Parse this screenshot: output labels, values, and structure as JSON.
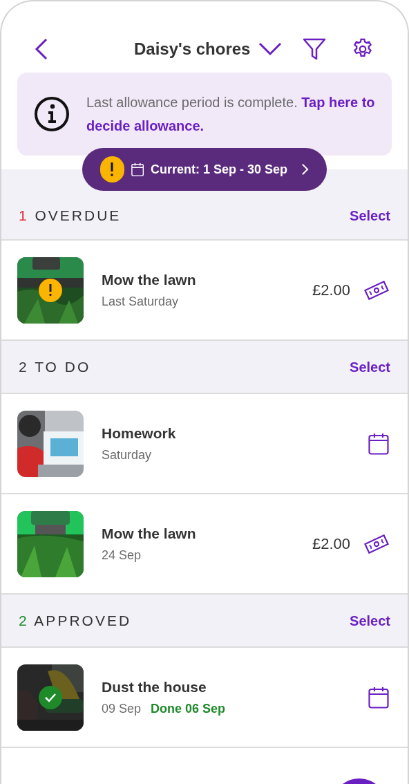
{
  "header": {
    "title": "Daisy's chores"
  },
  "banner": {
    "text": "Last allowance period is complete. **Tap here to decide allowance.**"
  },
  "period": {
    "label": "Current: 1 Sep - 30 Sep",
    "warning": true
  },
  "sections": [
    {
      "count": "1",
      "label": "OVERDUE",
      "color": "#e0283c",
      "action": "Select",
      "items": [
        {
          "title": "Mow the lawn",
          "subtitle": "Last Saturday",
          "warning": true,
          "approved": false,
          "kind": "reward",
          "amount": "£2.00"
        }
      ]
    },
    {
      "count": "2",
      "label": "TO DO",
      "color": "#3a3a3a",
      "action": "Select",
      "items": [
        {
          "title": "Homework",
          "subtitle": "Saturday",
          "warning": false,
          "approved": false,
          "kind": "scheduled"
        },
        {
          "title": "Mow the lawn",
          "subtitle": "24 Sep",
          "warning": false,
          "approved": false,
          "kind": "reward",
          "amount": "£2.00"
        }
      ]
    },
    {
      "count": "2",
      "label": "APPROVED",
      "color": "#1f8a2a",
      "action": "Select",
      "items": [
        {
          "title": "Dust the house",
          "subtitle": "09 Sep",
          "done": "Done 06 Sep",
          "warning": false,
          "approved": true,
          "kind": "scheduled"
        }
      ]
    }
  ]
}
